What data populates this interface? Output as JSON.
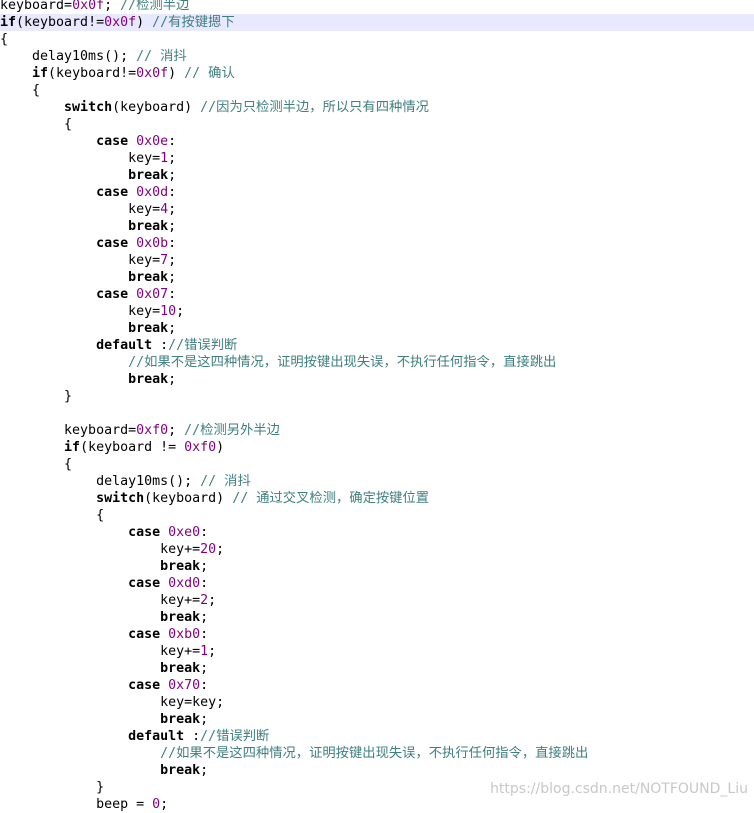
{
  "editor": {
    "lines": [
      [
        {
          "t": "keyboard=",
          "c": "pl"
        },
        {
          "t": "0x0f",
          "c": "num"
        },
        {
          "t": "; ",
          "c": "pl"
        },
        {
          "t": "//检测半边",
          "c": "cm"
        }
      ],
      [
        {
          "t": "if",
          "c": "kw"
        },
        {
          "t": "(keyboard!=",
          "c": "pl"
        },
        {
          "t": "0x0f",
          "c": "num"
        },
        {
          "t": ") ",
          "c": "pl"
        },
        {
          "t": "//有按键摁下",
          "c": "cm"
        }
      ],
      [
        {
          "t": "{",
          "c": "pl"
        }
      ],
      [
        {
          "t": "    delay10ms(); ",
          "c": "pl"
        },
        {
          "t": "// 消抖",
          "c": "cm"
        }
      ],
      [
        {
          "t": "    ",
          "c": "pl"
        },
        {
          "t": "if",
          "c": "kw"
        },
        {
          "t": "(keyboard!=",
          "c": "pl"
        },
        {
          "t": "0x0f",
          "c": "num"
        },
        {
          "t": ") ",
          "c": "pl"
        },
        {
          "t": "// 确认",
          "c": "cm"
        }
      ],
      [
        {
          "t": "    {",
          "c": "pl"
        }
      ],
      [
        {
          "t": "        ",
          "c": "pl"
        },
        {
          "t": "switch",
          "c": "kw"
        },
        {
          "t": "(keyboard) ",
          "c": "pl"
        },
        {
          "t": "//因为只检测半边，所以只有四种情况",
          "c": "cm"
        }
      ],
      [
        {
          "t": "        {",
          "c": "pl"
        }
      ],
      [
        {
          "t": "            ",
          "c": "pl"
        },
        {
          "t": "case",
          "c": "kw"
        },
        {
          "t": " ",
          "c": "pl"
        },
        {
          "t": "0x0e",
          "c": "num"
        },
        {
          "t": ":",
          "c": "pl"
        }
      ],
      [
        {
          "t": "                key=",
          "c": "pl"
        },
        {
          "t": "1",
          "c": "num"
        },
        {
          "t": ";",
          "c": "pl"
        }
      ],
      [
        {
          "t": "                ",
          "c": "pl"
        },
        {
          "t": "break",
          "c": "kw"
        },
        {
          "t": ";",
          "c": "pl"
        }
      ],
      [
        {
          "t": "            ",
          "c": "pl"
        },
        {
          "t": "case",
          "c": "kw"
        },
        {
          "t": " ",
          "c": "pl"
        },
        {
          "t": "0x0d",
          "c": "num"
        },
        {
          "t": ":",
          "c": "pl"
        }
      ],
      [
        {
          "t": "                key=",
          "c": "pl"
        },
        {
          "t": "4",
          "c": "num"
        },
        {
          "t": ";",
          "c": "pl"
        }
      ],
      [
        {
          "t": "                ",
          "c": "pl"
        },
        {
          "t": "break",
          "c": "kw"
        },
        {
          "t": ";",
          "c": "pl"
        }
      ],
      [
        {
          "t": "            ",
          "c": "pl"
        },
        {
          "t": "case",
          "c": "kw"
        },
        {
          "t": " ",
          "c": "pl"
        },
        {
          "t": "0x0b",
          "c": "num"
        },
        {
          "t": ":",
          "c": "pl"
        }
      ],
      [
        {
          "t": "                key=",
          "c": "pl"
        },
        {
          "t": "7",
          "c": "num"
        },
        {
          "t": ";",
          "c": "pl"
        }
      ],
      [
        {
          "t": "                ",
          "c": "pl"
        },
        {
          "t": "break",
          "c": "kw"
        },
        {
          "t": ";",
          "c": "pl"
        }
      ],
      [
        {
          "t": "            ",
          "c": "pl"
        },
        {
          "t": "case",
          "c": "kw"
        },
        {
          "t": " ",
          "c": "pl"
        },
        {
          "t": "0x07",
          "c": "num"
        },
        {
          "t": ":",
          "c": "pl"
        }
      ],
      [
        {
          "t": "                key=",
          "c": "pl"
        },
        {
          "t": "10",
          "c": "num"
        },
        {
          "t": ";",
          "c": "pl"
        }
      ],
      [
        {
          "t": "                ",
          "c": "pl"
        },
        {
          "t": "break",
          "c": "kw"
        },
        {
          "t": ";",
          "c": "pl"
        }
      ],
      [
        {
          "t": "            ",
          "c": "pl"
        },
        {
          "t": "default",
          "c": "kw"
        },
        {
          "t": " :",
          "c": "pl"
        },
        {
          "t": "//错误判断",
          "c": "cm"
        }
      ],
      [
        {
          "t": "                ",
          "c": "pl"
        },
        {
          "t": "//如果不是这四种情况，证明按键出现失误，不执行任何指令，直接跳出",
          "c": "cm"
        }
      ],
      [
        {
          "t": "                ",
          "c": "pl"
        },
        {
          "t": "break",
          "c": "kw"
        },
        {
          "t": ";",
          "c": "pl"
        }
      ],
      [
        {
          "t": "        }",
          "c": "pl"
        }
      ],
      [],
      [
        {
          "t": "        keyboard=",
          "c": "pl"
        },
        {
          "t": "0xf0",
          "c": "num"
        },
        {
          "t": "; ",
          "c": "pl"
        },
        {
          "t": "//检测另外半边",
          "c": "cm"
        }
      ],
      [
        {
          "t": "        ",
          "c": "pl"
        },
        {
          "t": "if",
          "c": "kw"
        },
        {
          "t": "(keyboard != ",
          "c": "pl"
        },
        {
          "t": "0xf0",
          "c": "num"
        },
        {
          "t": ")",
          "c": "pl"
        }
      ],
      [
        {
          "t": "        {",
          "c": "pl"
        }
      ],
      [
        {
          "t": "            delay10ms(); ",
          "c": "pl"
        },
        {
          "t": "// 消抖",
          "c": "cm"
        }
      ],
      [
        {
          "t": "            ",
          "c": "pl"
        },
        {
          "t": "switch",
          "c": "kw"
        },
        {
          "t": "(keyboard) ",
          "c": "pl"
        },
        {
          "t": "// 通过交叉检测，确定按键位置",
          "c": "cm"
        }
      ],
      [
        {
          "t": "            {",
          "c": "pl"
        }
      ],
      [
        {
          "t": "                ",
          "c": "pl"
        },
        {
          "t": "case",
          "c": "kw"
        },
        {
          "t": " ",
          "c": "pl"
        },
        {
          "t": "0xe0",
          "c": "num"
        },
        {
          "t": ":",
          "c": "pl"
        }
      ],
      [
        {
          "t": "                    key+=",
          "c": "pl"
        },
        {
          "t": "20",
          "c": "num"
        },
        {
          "t": ";",
          "c": "pl"
        }
      ],
      [
        {
          "t": "                    ",
          "c": "pl"
        },
        {
          "t": "break",
          "c": "kw"
        },
        {
          "t": ";",
          "c": "pl"
        }
      ],
      [
        {
          "t": "                ",
          "c": "pl"
        },
        {
          "t": "case",
          "c": "kw"
        },
        {
          "t": " ",
          "c": "pl"
        },
        {
          "t": "0xd0",
          "c": "num"
        },
        {
          "t": ":",
          "c": "pl"
        }
      ],
      [
        {
          "t": "                    key+=",
          "c": "pl"
        },
        {
          "t": "2",
          "c": "num"
        },
        {
          "t": ";",
          "c": "pl"
        }
      ],
      [
        {
          "t": "                    ",
          "c": "pl"
        },
        {
          "t": "break",
          "c": "kw"
        },
        {
          "t": ";",
          "c": "pl"
        }
      ],
      [
        {
          "t": "                ",
          "c": "pl"
        },
        {
          "t": "case",
          "c": "kw"
        },
        {
          "t": " ",
          "c": "pl"
        },
        {
          "t": "0xb0",
          "c": "num"
        },
        {
          "t": ":",
          "c": "pl"
        }
      ],
      [
        {
          "t": "                    key+=",
          "c": "pl"
        },
        {
          "t": "1",
          "c": "num"
        },
        {
          "t": ";",
          "c": "pl"
        }
      ],
      [
        {
          "t": "                    ",
          "c": "pl"
        },
        {
          "t": "break",
          "c": "kw"
        },
        {
          "t": ";",
          "c": "pl"
        }
      ],
      [
        {
          "t": "                ",
          "c": "pl"
        },
        {
          "t": "case",
          "c": "kw"
        },
        {
          "t": " ",
          "c": "pl"
        },
        {
          "t": "0x70",
          "c": "num"
        },
        {
          "t": ":",
          "c": "pl"
        }
      ],
      [
        {
          "t": "                    key=key;",
          "c": "pl"
        }
      ],
      [
        {
          "t": "                    ",
          "c": "pl"
        },
        {
          "t": "break",
          "c": "kw"
        },
        {
          "t": ";",
          "c": "pl"
        }
      ],
      [
        {
          "t": "                ",
          "c": "pl"
        },
        {
          "t": "default",
          "c": "kw"
        },
        {
          "t": " :",
          "c": "pl"
        },
        {
          "t": "//错误判断",
          "c": "cm"
        }
      ],
      [
        {
          "t": "                    ",
          "c": "pl"
        },
        {
          "t": "//如果不是这四种情况，证明按键出现失误，不执行任何指令，直接跳出",
          "c": "cm"
        }
      ],
      [
        {
          "t": "                    ",
          "c": "pl"
        },
        {
          "t": "break",
          "c": "kw"
        },
        {
          "t": ";",
          "c": "pl"
        }
      ],
      [
        {
          "t": "            }",
          "c": "pl"
        }
      ],
      [
        {
          "t": "            beep = ",
          "c": "pl"
        },
        {
          "t": "0",
          "c": "num"
        },
        {
          "t": ";",
          "c": "pl"
        }
      ]
    ],
    "current_line": 1,
    "colors": {
      "keyword": "#000000",
      "number": "#7f007f",
      "comment": "#3f7f7f",
      "current_line_bg": "#e8e8ff"
    }
  },
  "watermark": {
    "text": "https://blog.csdn.net/NOTFOUND_Liu"
  }
}
